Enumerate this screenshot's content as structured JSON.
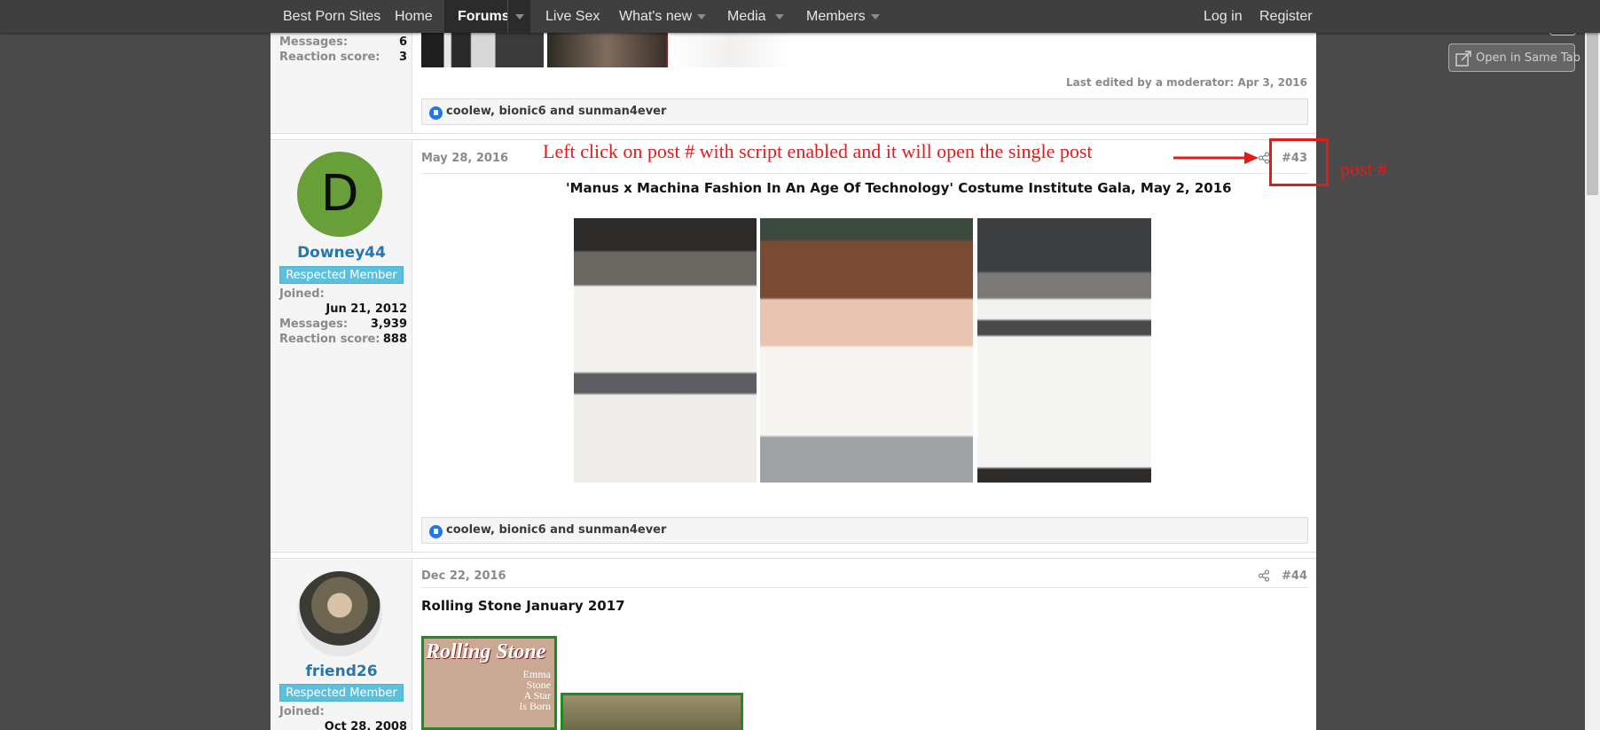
{
  "nav": {
    "items": [
      {
        "label": "Best Porn Sites"
      },
      {
        "label": "Home"
      },
      {
        "label": "Forums"
      },
      {
        "label": "Live Sex"
      },
      {
        "label": "What's new"
      },
      {
        "label": "Media"
      },
      {
        "label": "Members"
      }
    ],
    "login": "Log in",
    "register": "Register"
  },
  "ext": {
    "open_same_tab": "Open in Same Tab"
  },
  "post_prev": {
    "stats": [
      {
        "label": "Messages:",
        "value": "6"
      },
      {
        "label": "Reaction score:",
        "value": "3"
      }
    ],
    "edited": "Last edited by a moderator: Apr 3, 2016",
    "reactions": "coolew, bionic6 and sunman4ever"
  },
  "post43": {
    "date": "May 28, 2016",
    "avatar_letter": "D",
    "username": "Downey44",
    "badge": "Respected Member",
    "joined_label": "Joined:",
    "joined": "Jun 21, 2012",
    "stats": [
      {
        "label": "Messages:",
        "value": "3,939"
      },
      {
        "label": "Reaction score:",
        "value": "888"
      }
    ],
    "number": "#43",
    "title": "'Manus x Machina Fashion In An Age Of Technology' Costume Institute Gala, May 2, 2016",
    "reactions": "coolew, bionic6 and sunman4ever"
  },
  "post44": {
    "date": "Dec 22, 2016",
    "username": "friend26",
    "badge": "Respected Member",
    "joined_label": "Joined:",
    "joined": "Oct 28, 2008",
    "number": "#44",
    "title": "Rolling Stone January 2017",
    "magazine": {
      "brand": "Rolling Stone",
      "cover_lines": [
        "Emma",
        "Stone",
        "A Star",
        "Is Born"
      ]
    }
  },
  "annotation": {
    "instruction": "Left click on post # with script enabled and it will open the single post",
    "label": "post #"
  },
  "colors": {
    "accent": "#2577b1",
    "badge": "#5bc0de",
    "annotation": "#e31b1b"
  }
}
